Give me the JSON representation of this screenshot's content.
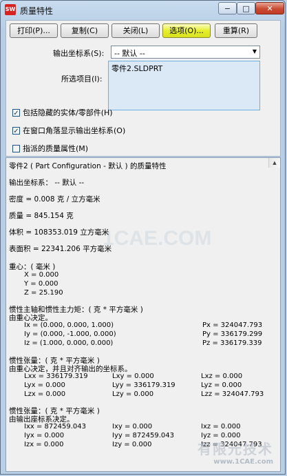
{
  "window": {
    "title": "质量特性",
    "app_icon_label": "SW",
    "min_glyph": "−",
    "max_glyph": "□",
    "close_glyph": "✕"
  },
  "toolbar": {
    "print": "打印(P)...",
    "copy": "复制(C)",
    "close": "关闭(L)",
    "options": "选项(O)...",
    "recalc": "重算(R)"
  },
  "form": {
    "output_cs_label": "输出坐标系(S):",
    "output_cs_value": "-- 默认 --",
    "selected_label": "所选项目(I):",
    "selected_items": [
      "零件2.SLDPRT"
    ],
    "dropdown_glyph": "▼"
  },
  "options": {
    "include_hidden": {
      "label": "包括隐藏的实体/零部件(H)",
      "checked": true
    },
    "show_corner_cs": {
      "label": "在窗口角落显示输出坐标系(O)",
      "checked": true
    },
    "assigned_mass": {
      "label": "指派的质量属性(M)",
      "checked": false
    },
    "check_glyph": "✓"
  },
  "results": {
    "scroll_glyph": "▲",
    "header": "零件2 ( Part Configuration - 默认 ) 的质量特性",
    "output_cs": "输出坐标系： -- 默认 --",
    "density": "密度 = 0.008 克 / 立方毫米",
    "mass": "质量 = 845.154 克",
    "volume": "体积 = 108353.019  立方毫米",
    "area": "表面积 = 22341.206  平方毫米",
    "cog_title": "重心：( 毫米 )",
    "cog": [
      "X = 0.000",
      "Y = 0.000",
      "Z = 25.190"
    ],
    "principal_title": "惯性主轴和惯性主力矩：( 克 *  平方毫米 )",
    "principal_sub": "由重心决定。",
    "principal_axes": [
      {
        "axis": "Ix = (0.000, 0.000, 1.000)",
        "moment": "Px = 324047.793"
      },
      {
        "axis": "Iy = (0.000, -1.000, 0.000)",
        "moment": "Py = 336179.299"
      },
      {
        "axis": "Iz = (1.000, 0.000, 0.000)",
        "moment": "Pz = 336179.339"
      }
    ],
    "cog_tensor_title": "惯性张量：( 克 *  平方毫米 )",
    "cog_tensor_sub": "由重心决定，并且对齐输出的坐标系。",
    "cog_tensor": [
      [
        "Lxx = 336179.319",
        "Lxy = 0.000",
        "Lxz = 0.000"
      ],
      [
        "Lyx = 0.000",
        "Lyy = 336179.319",
        "Lyz = 0.000"
      ],
      [
        "Lzx = 0.000",
        "Lzy = 0.000",
        "Lzz = 324047.793"
      ]
    ],
    "out_tensor_title": "惯性张量：( 克 *  平方毫米 )",
    "out_tensor_sub": "由输出座标系决定。",
    "out_tensor": [
      [
        "Ixx = 872459.043",
        "Ixy = 0.000",
        "Ixz = 0.000"
      ],
      [
        "Iyx = 0.000",
        "Iyy = 872459.043",
        "Iyz = 0.000"
      ],
      [
        "Izx = 0.000",
        "Izy = 0.000",
        "Izz = 324047.793"
      ]
    ]
  },
  "watermarks": {
    "center": "1CAE.COM",
    "corner_title": "有限元技术",
    "corner_url": "www.1CAE.com"
  }
}
